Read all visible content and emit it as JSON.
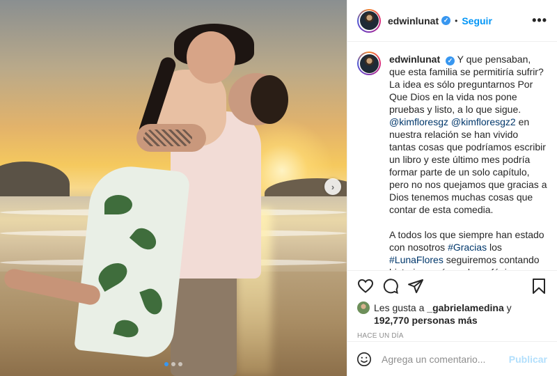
{
  "photo": {
    "alt_description": "",
    "carousel": {
      "total": 3,
      "active": 1
    },
    "next_icon": "chevron-right-icon"
  },
  "header": {
    "username": "edwinlunat",
    "verified": true,
    "separator": "•",
    "follow_label": "Seguir",
    "more_icon": "ellipsis-icon",
    "more_label": "•••"
  },
  "caption": {
    "username": "edwinlunat",
    "paragraph1_a": "Y que pensaban, que esta familia se permitiría sufrir? La idea es sólo preguntarnos Por Que Dios en la vida nos pone pruebas y listo, a lo que sigue. ",
    "mention1": "@kimfloresgz",
    "mention2": "@kimfloresgz2",
    "paragraph1_b": " en nuestra relación se han vivido tantas cosas que podríamos escribir un libro y este último mes podría formar parte de un solo capítulo, pero no nos quejamos que gracias a Dios tenemos muchas cosas que contar de esta comedia.",
    "paragraph2_a": "A todos los que siempre han estado con nosotros ",
    "hashtag1": "#Gracias",
    "paragraph2_b": " los ",
    "hashtag2": "#LunaFlores",
    "paragraph2_c": " seguiremos contando historias y cómo el ave fénix renacimos y a volar tan alto como se pueda "
  },
  "actions": {
    "like_icon": "heart-icon",
    "comment_icon": "comment-icon",
    "share_icon": "share-icon",
    "save_icon": "bookmark-icon"
  },
  "likes": {
    "prefix": "Les gusta a ",
    "user": "_gabrielamedina",
    "conjunction": " y",
    "count_text": "192,770 personas más"
  },
  "timestamp": "HACE UN DÍA",
  "comment_box": {
    "emoji_icon": "smiley-icon",
    "placeholder": "Agrega un comentario...",
    "publish_label": "Publicar"
  },
  "colors": {
    "link": "#00376b",
    "accent": "#0095f6",
    "verified": "#3897f0",
    "publish_disabled": "#b2dffc"
  }
}
